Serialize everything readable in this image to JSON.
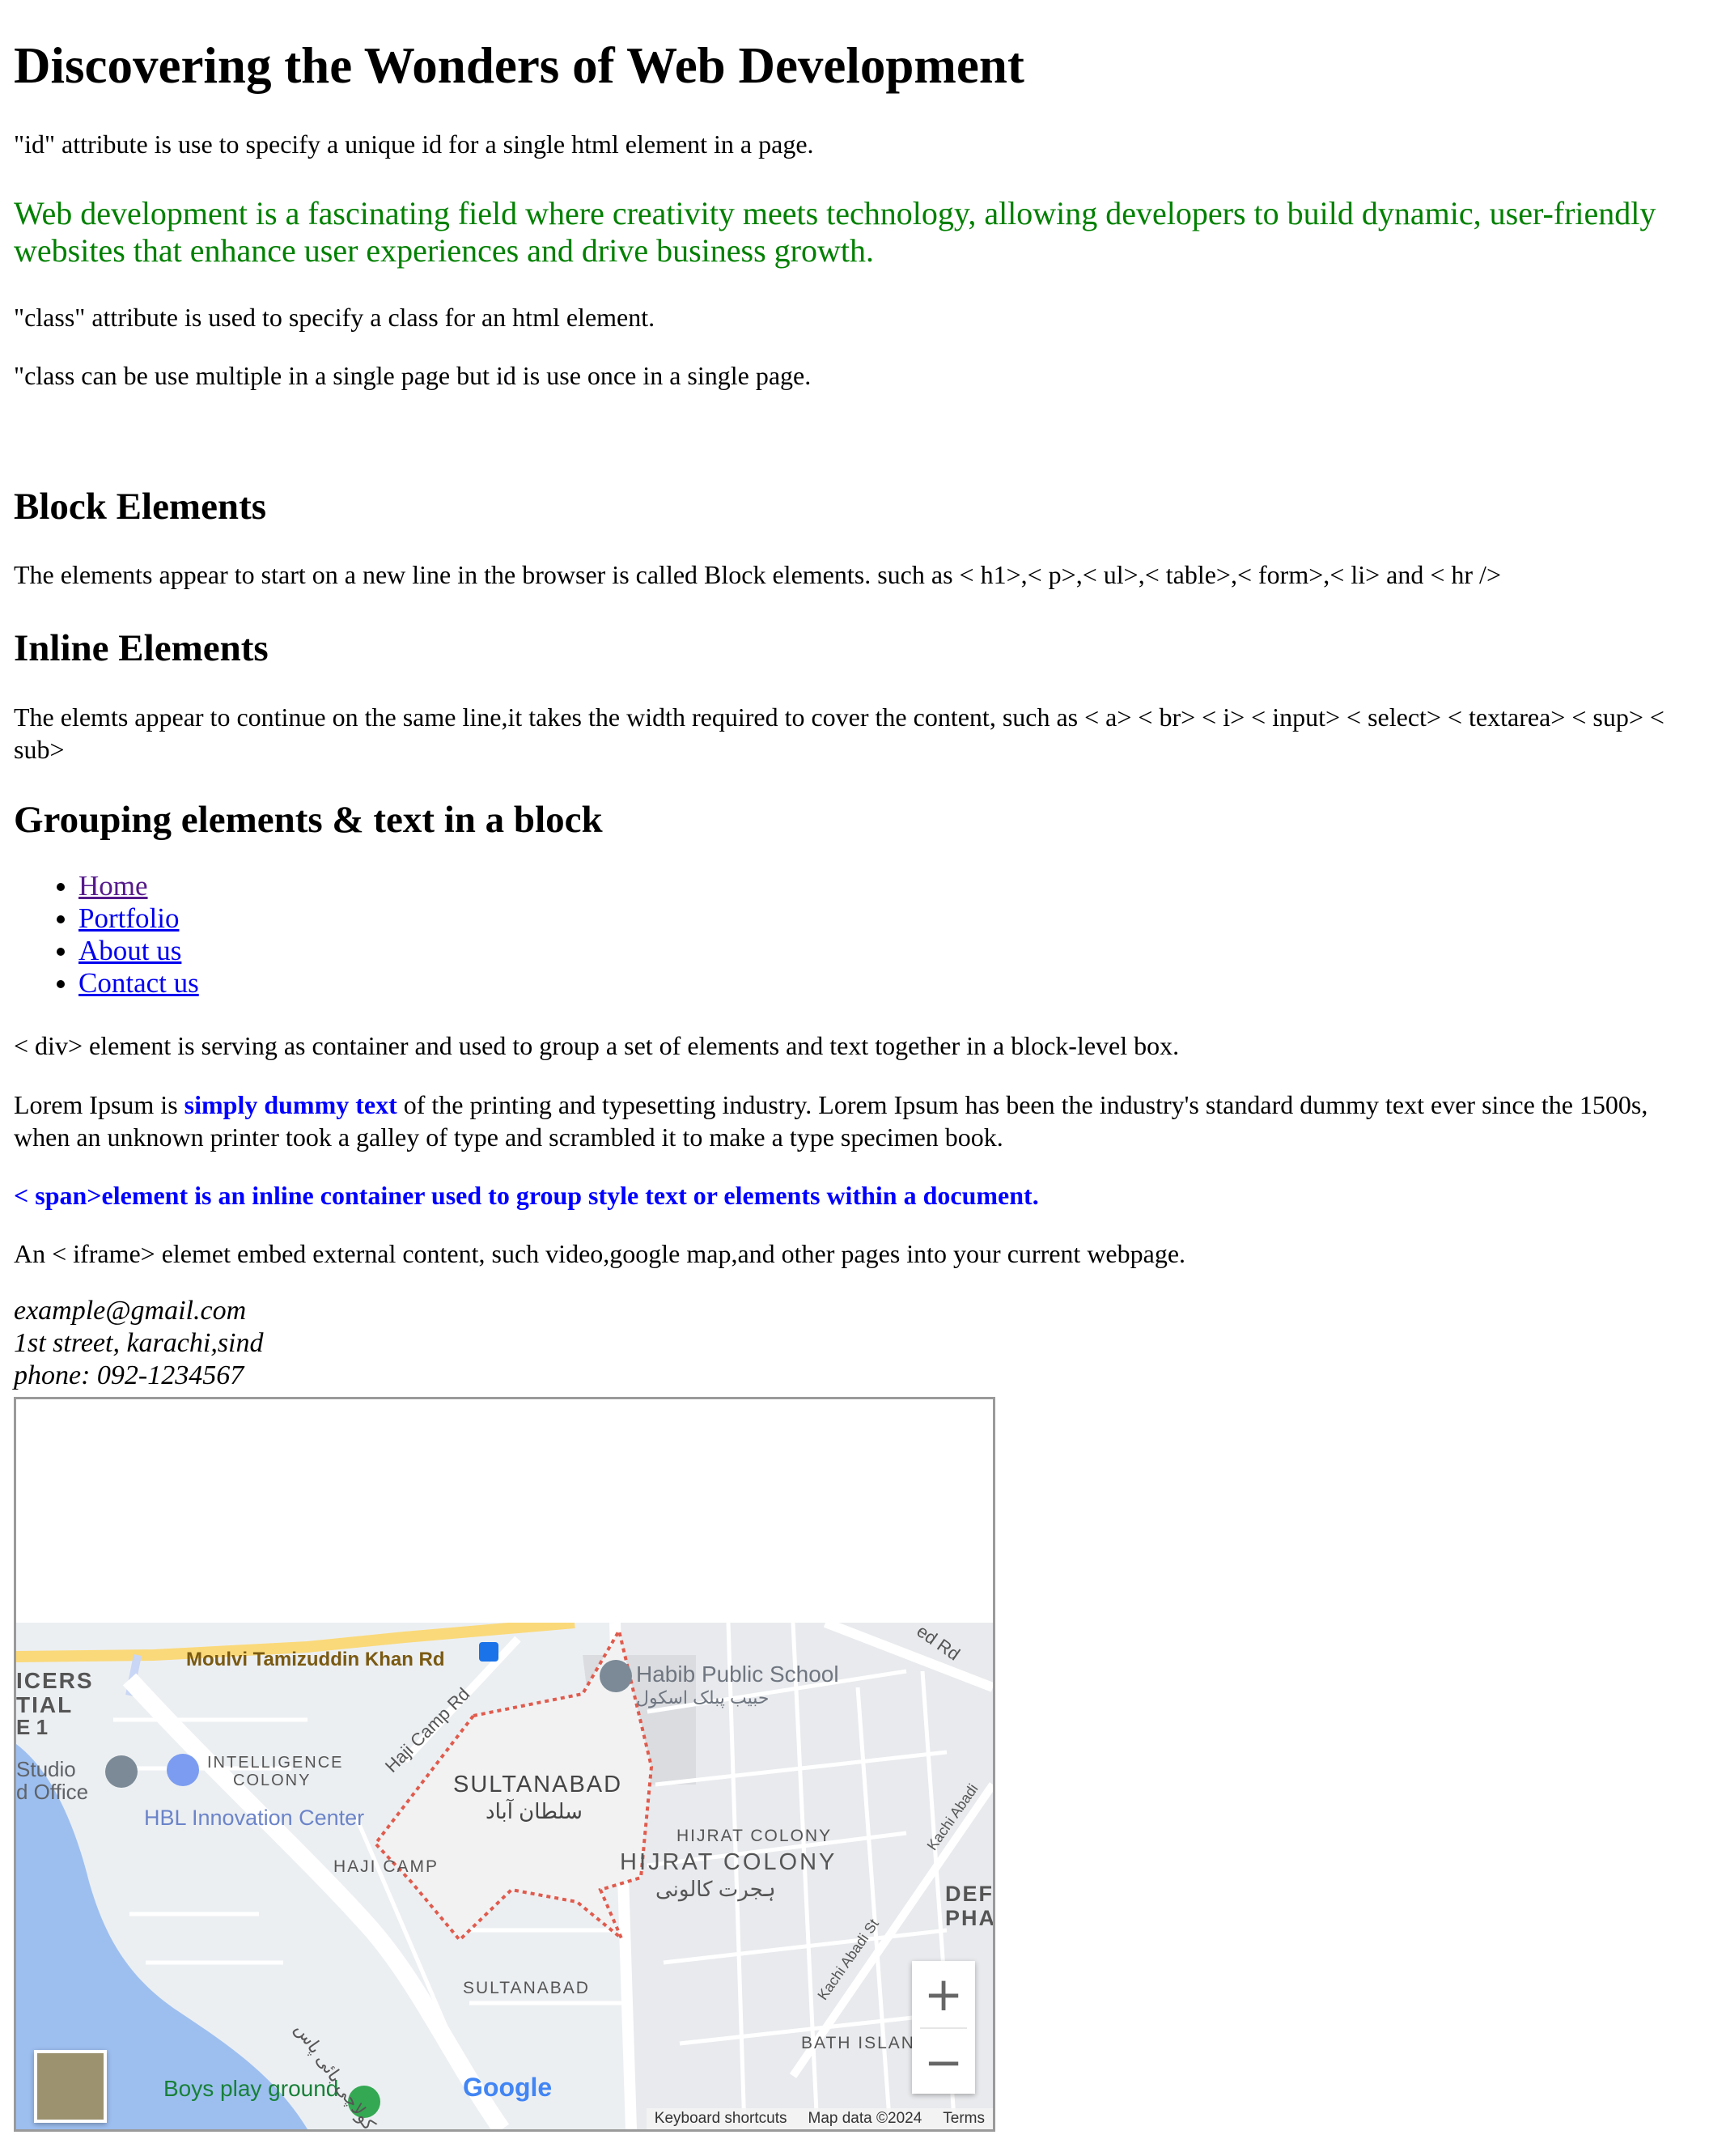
{
  "heading": "Discovering the Wonders of Web Development",
  "id_note": "\"id\" attribute is use to specify a unique id for a single html element in a page.",
  "intro_green": "Web development is a fascinating field where creativity meets technology, allowing developers to build dynamic, user-friendly websites that enhance user experiences and drive business growth.",
  "class_note": "\"class\" attribute is used to specify a class for an html element.",
  "class_vs_id": "\"class can be use multiple in a single page but id is use once in a single page.",
  "block": {
    "title": "Block Elements",
    "text": "The elements appear to start on a new line in the browser is called Block elements. such as < h1>,< p>,< ul>,< table>,< form>,< li> and < hr />"
  },
  "inline": {
    "title": "Inline Elements",
    "text": "The elemts appear to continue on the same line,it takes the width required to cover the content, such as < a> < br> < i> < input> < select> < textarea> < sup> < sub>"
  },
  "grouping": {
    "title": "Grouping elements & text in a block",
    "nav_items": [
      "Home",
      "Portfolio",
      "About us",
      "Contact us"
    ],
    "div_note": "< div> element is serving as container and used to group a set of elements and text together in a block-level box.",
    "lorem_before": "Lorem Ipsum is ",
    "lorem_highlight": "simply dummy text",
    "lorem_after": " of the printing and typesetting industry. Lorem Ipsum has been the industry's standard dummy text ever since the 1500s, when an unknown printer took a galley of type and scrambled it to make a type specimen book.",
    "span_note": "< span>element is an inline container used to group style text or elements within a document.",
    "iframe_note": "An < iframe> elemet embed external content, such video,google map,and other pages into your current webpage."
  },
  "address": {
    "email": "example@gmail.com",
    "street": "1st street, karachi,sind",
    "phone": "phone: 092-1234567"
  },
  "map": {
    "labels": {
      "road_top": "Moulvi Tamizuddin Khan Rd",
      "road_haji": "Haji Camp Rd",
      "road_ed": "ed Rd",
      "icers": "ICERS",
      "tial": "TIAL",
      "e1": "E 1",
      "studio": "Studio",
      "office": "d Office",
      "habib": "Habib Public School",
      "habib_ur": "حبیب پبلک اسکول",
      "intel": "INTELLIGENCE",
      "colony": "COLONY",
      "hbl": "HBL Innovation Center",
      "sultanabad": "SULTANABAD",
      "sultanabad_ur": "سلطان آباد",
      "hijrat_small": "HIJRAT COLONY",
      "hijrat": "HIJRAT COLONY",
      "hijrat_ur": "ہجرت کالونی",
      "haji_camp": "HAJI CAMP",
      "sultanabad_small": "SULTANABAD",
      "kachi1": "Kachi Abadi St",
      "kachi2": "Kachi Abadi",
      "def": "DEF",
      "pha": "PHA",
      "bath": "BATH ISLAN",
      "boys": "Boys play ground",
      "mai": "مائی کولاچی بائی پاس"
    },
    "google": "Google",
    "zoom_in": "+",
    "zoom_out": "−",
    "keyboard": "Keyboard shortcuts",
    "map_data": "Map data ©2024",
    "terms": "Terms"
  }
}
